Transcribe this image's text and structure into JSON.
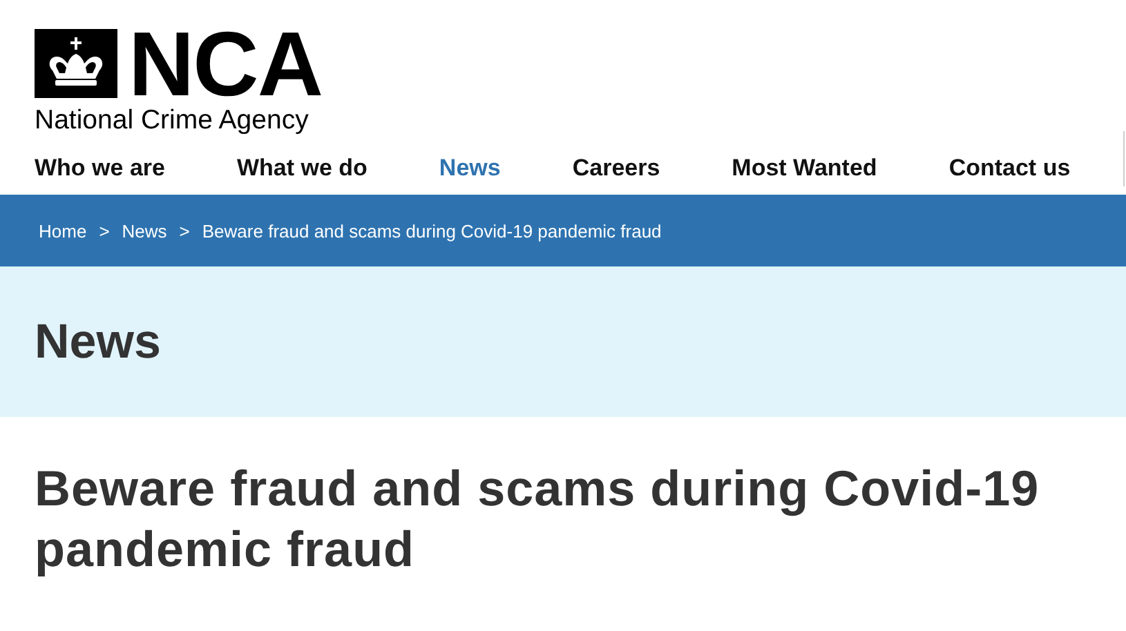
{
  "logo": {
    "wordmark": "NCA",
    "subtitle": "National Crime Agency"
  },
  "nav": [
    {
      "label": "Who we are",
      "selected": false
    },
    {
      "label": "What we do",
      "selected": false
    },
    {
      "label": "News",
      "selected": true
    },
    {
      "label": "Careers",
      "selected": false
    },
    {
      "label": "Most Wanted",
      "selected": false
    },
    {
      "label": "Contact us",
      "selected": false
    }
  ],
  "breadcrumb": [
    {
      "label": "Home",
      "separator": ">"
    },
    {
      "label": "News",
      "separator": ">"
    },
    {
      "label": "Beware fraud and scams during Covid-19 pandemic fraud"
    }
  ],
  "section_title": "News",
  "article_title": "Beware fraud and scams during Covid-19 pandemic fraud"
}
